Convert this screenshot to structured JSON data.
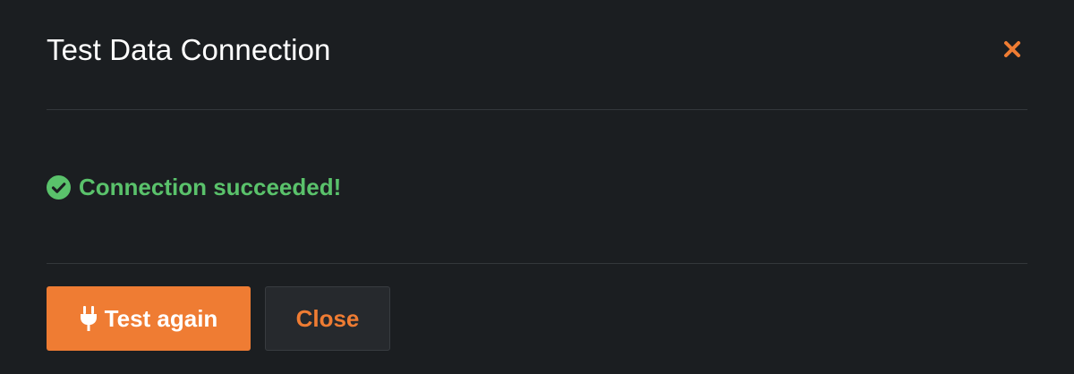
{
  "dialog": {
    "title": "Test Data Connection",
    "close_icon": "close-x-icon",
    "status": {
      "icon": "check-circle-icon",
      "text": "Connection succeeded!",
      "color": "#5ac26b"
    },
    "buttons": {
      "test_again": {
        "label": "Test again",
        "icon": "plug-icon"
      },
      "close": {
        "label": "Close"
      }
    }
  },
  "colors": {
    "background": "#1b1e21",
    "accent": "#ef7c33",
    "success": "#5ac26b",
    "divider": "#33373b",
    "secondary_button_bg": "#26292d"
  }
}
